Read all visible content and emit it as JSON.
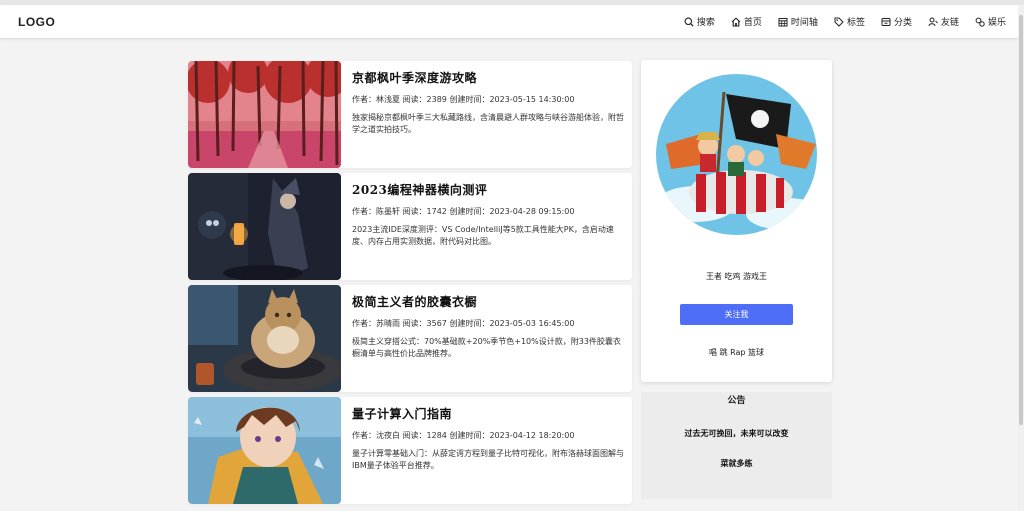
{
  "header": {
    "logo": "LOGO",
    "nav": [
      {
        "label": "搜索",
        "icon": "search-icon"
      },
      {
        "label": "首页",
        "icon": "home-icon"
      },
      {
        "label": "时间轴",
        "icon": "calendar-icon"
      },
      {
        "label": "标签",
        "icon": "tag-icon"
      },
      {
        "label": "分类",
        "icon": "category-icon"
      },
      {
        "label": "友链",
        "icon": "friend-link-icon"
      },
      {
        "label": "娱乐",
        "icon": "entertainment-icon"
      }
    ]
  },
  "posts": [
    {
      "title": "京都枫叶季深度游攻略",
      "meta": "作者：林浅夏 阅读：2389 创建时间：2023-05-15 14:30:00",
      "desc": "独家揭秘京都枫叶季三大私藏路线，含清晨避人群攻略与峡谷游船体验，附哲学之道实拍技巧。"
    },
    {
      "title": "2023编程神器横向测评",
      "meta": "作者：陈墨轩 阅读：1742 创建时间：2023-04-28 09:15:00",
      "desc": "2023主流IDE深度测评：VS Code/IntelliJ等5款工具性能大PK，含启动速度、内存占用实测数据，附代码对比图。"
    },
    {
      "title": "极简主义者的胶囊衣橱",
      "meta": "作者：苏晴雨 阅读：3567 创建时间：2023-05-03 16:45:00",
      "desc": "极简主义穿搭公式：70%基础款+20%季节色+10%设计款，附33件胶囊衣橱清单与高性价比品牌推荐。"
    },
    {
      "title": "量子计算入门指南",
      "meta": "作者：沈夜白 阅读：1284 创建时间：2023-04-12 18:20:00",
      "desc": "量子计算零基础入门：从薛定谔方程到量子比特可视化，附布洛赫球面图解与IBM量子体验平台推荐。"
    }
  ],
  "profile": {
    "bio": "王者 吃鸡 游戏王",
    "follow_label": "关注我",
    "hobbies": "唱 跳 Rap 篮球"
  },
  "notice": {
    "title": "公告",
    "line1": "过去无可挽回，未来可以改变",
    "line2": "菜就多练"
  }
}
